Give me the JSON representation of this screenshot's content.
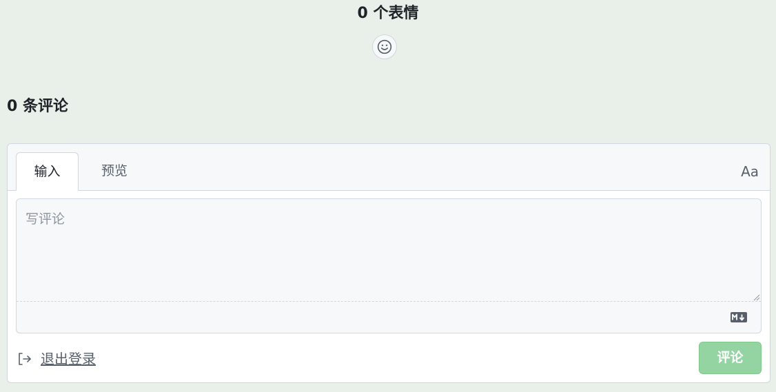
{
  "reactions": {
    "title": "0 个表情",
    "add_reaction_icon": "smiley-icon"
  },
  "comments": {
    "title": "0 条评论"
  },
  "editor": {
    "tabs": [
      {
        "label": "输入",
        "active": true
      },
      {
        "label": "预览",
        "active": false
      }
    ],
    "font_toggle_label": "Aa",
    "textarea_placeholder": "写评论",
    "textarea_value": "",
    "markdown_icon": "markdown-icon"
  },
  "footer": {
    "signout_icon": "sign-out-icon",
    "signout_label": "退出登录",
    "submit_label": "评论"
  },
  "colors": {
    "page_background": "#e9efe9",
    "submit_disabled": "#94d3a2",
    "border": "#d0d7de"
  }
}
